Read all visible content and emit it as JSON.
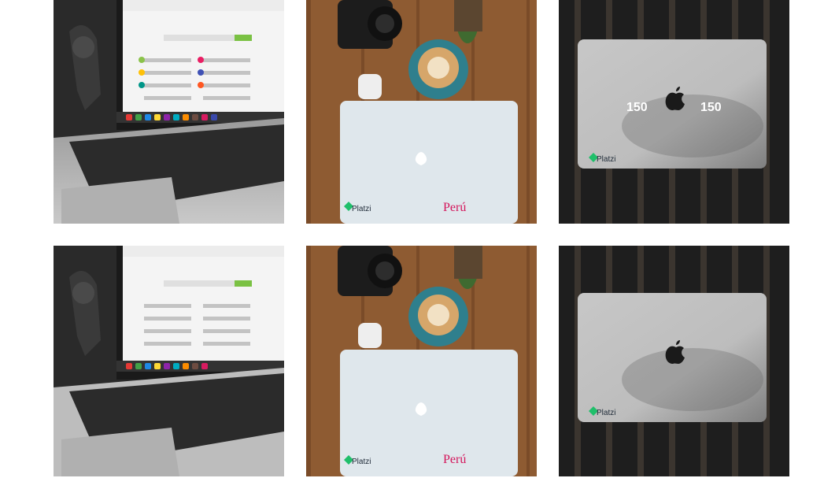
{
  "gallery": {
    "tiles": [
      {
        "photo": "laptop-open-desk",
        "brand": "Platzi"
      },
      {
        "photo": "laptop-coffee-table",
        "brand": "Platzi",
        "sticker": "Perú"
      },
      {
        "photo": "laptop-lid-top",
        "brand": "Platzi",
        "left_number": "150",
        "right_number": "150"
      },
      {
        "photo": "laptop-open-desk",
        "brand": "Platzi"
      },
      {
        "photo": "laptop-coffee-table",
        "brand": "Platzi",
        "sticker": "Perú"
      },
      {
        "photo": "laptop-lid-top",
        "brand": "Platzi"
      }
    ]
  },
  "colors": {
    "background": "#ffffff",
    "platzi_green": "#1fbf6a",
    "peru_red": "#d4145a"
  }
}
